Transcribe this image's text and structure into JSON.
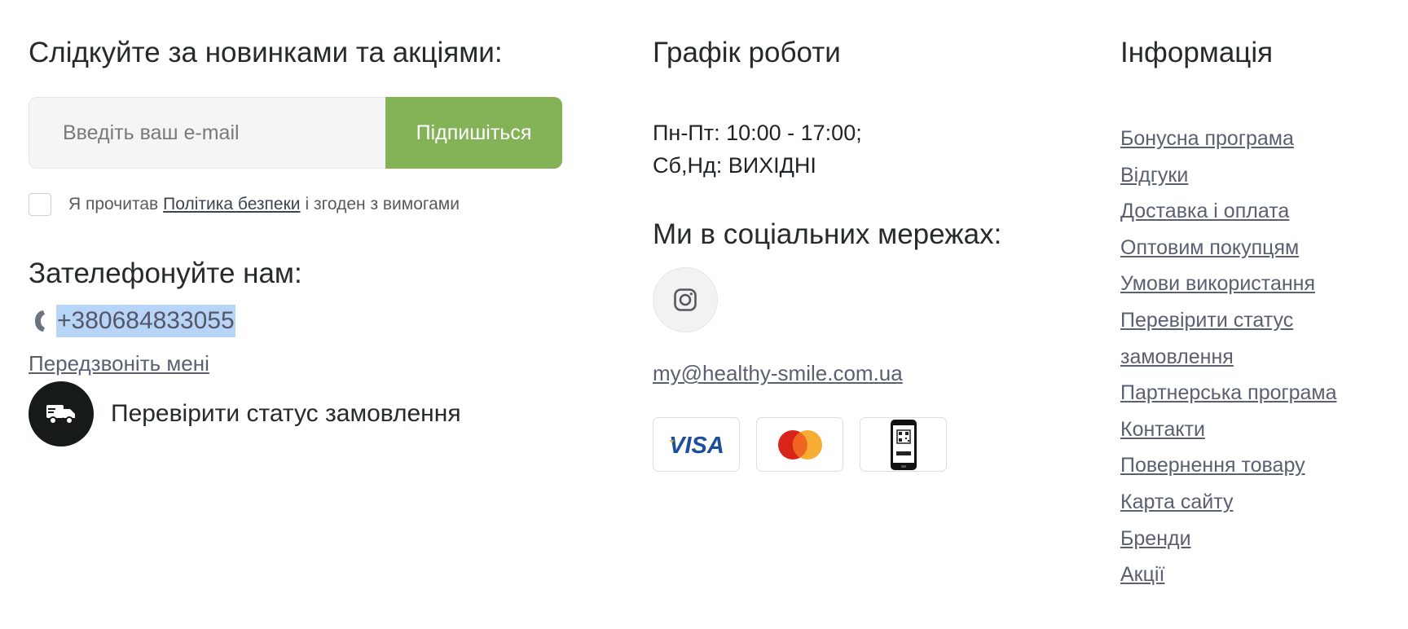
{
  "newsletter": {
    "heading": "Слідкуйте за новинками та акціями:",
    "email_placeholder": "Введіть ваш e-mail",
    "subscribe_label": "Підпишіться",
    "consent_prefix": "Я прочитав",
    "consent_link": "Політика безпеки",
    "consent_suffix": "і згоден з вимогами"
  },
  "contact": {
    "heading": "Зателефонуйте нам:",
    "phone": "+380684833055",
    "callback_label": "Передзвоніть мені",
    "order_status_label": "Перевірити статус замовлення"
  },
  "schedule": {
    "heading": "Графік роботи",
    "weekdays": "Пн-Пт: 10:00 - 17:00;",
    "weekend": "Сб,Нд: ВИХІДНІ"
  },
  "social": {
    "heading": "Ми в соціальних мережах:",
    "icons": [
      "instagram-icon"
    ],
    "email": "my@healthy-smile.com.ua"
  },
  "payments": {
    "icons": [
      "visa-logo",
      "mastercard-logo",
      "qr-phone-payment-icon"
    ],
    "visa_text": "VISA"
  },
  "info": {
    "heading": "Інформація",
    "links": [
      "Бонусна програма",
      "Відгуки",
      "Доставка і оплата",
      "Оптовим покупцям",
      "Умови використання",
      "Перевірити статус",
      "замовлення",
      "Партнерська програма",
      "Контакти",
      "Повернення товару",
      "Карта сайту",
      "Бренди",
      "Акції"
    ]
  },
  "colors": {
    "accent_green": "#84b357",
    "link": "#5a6072",
    "heading": "#262a2b",
    "highlight": "#b8d4f6",
    "truck_circle": "#161b1a"
  }
}
